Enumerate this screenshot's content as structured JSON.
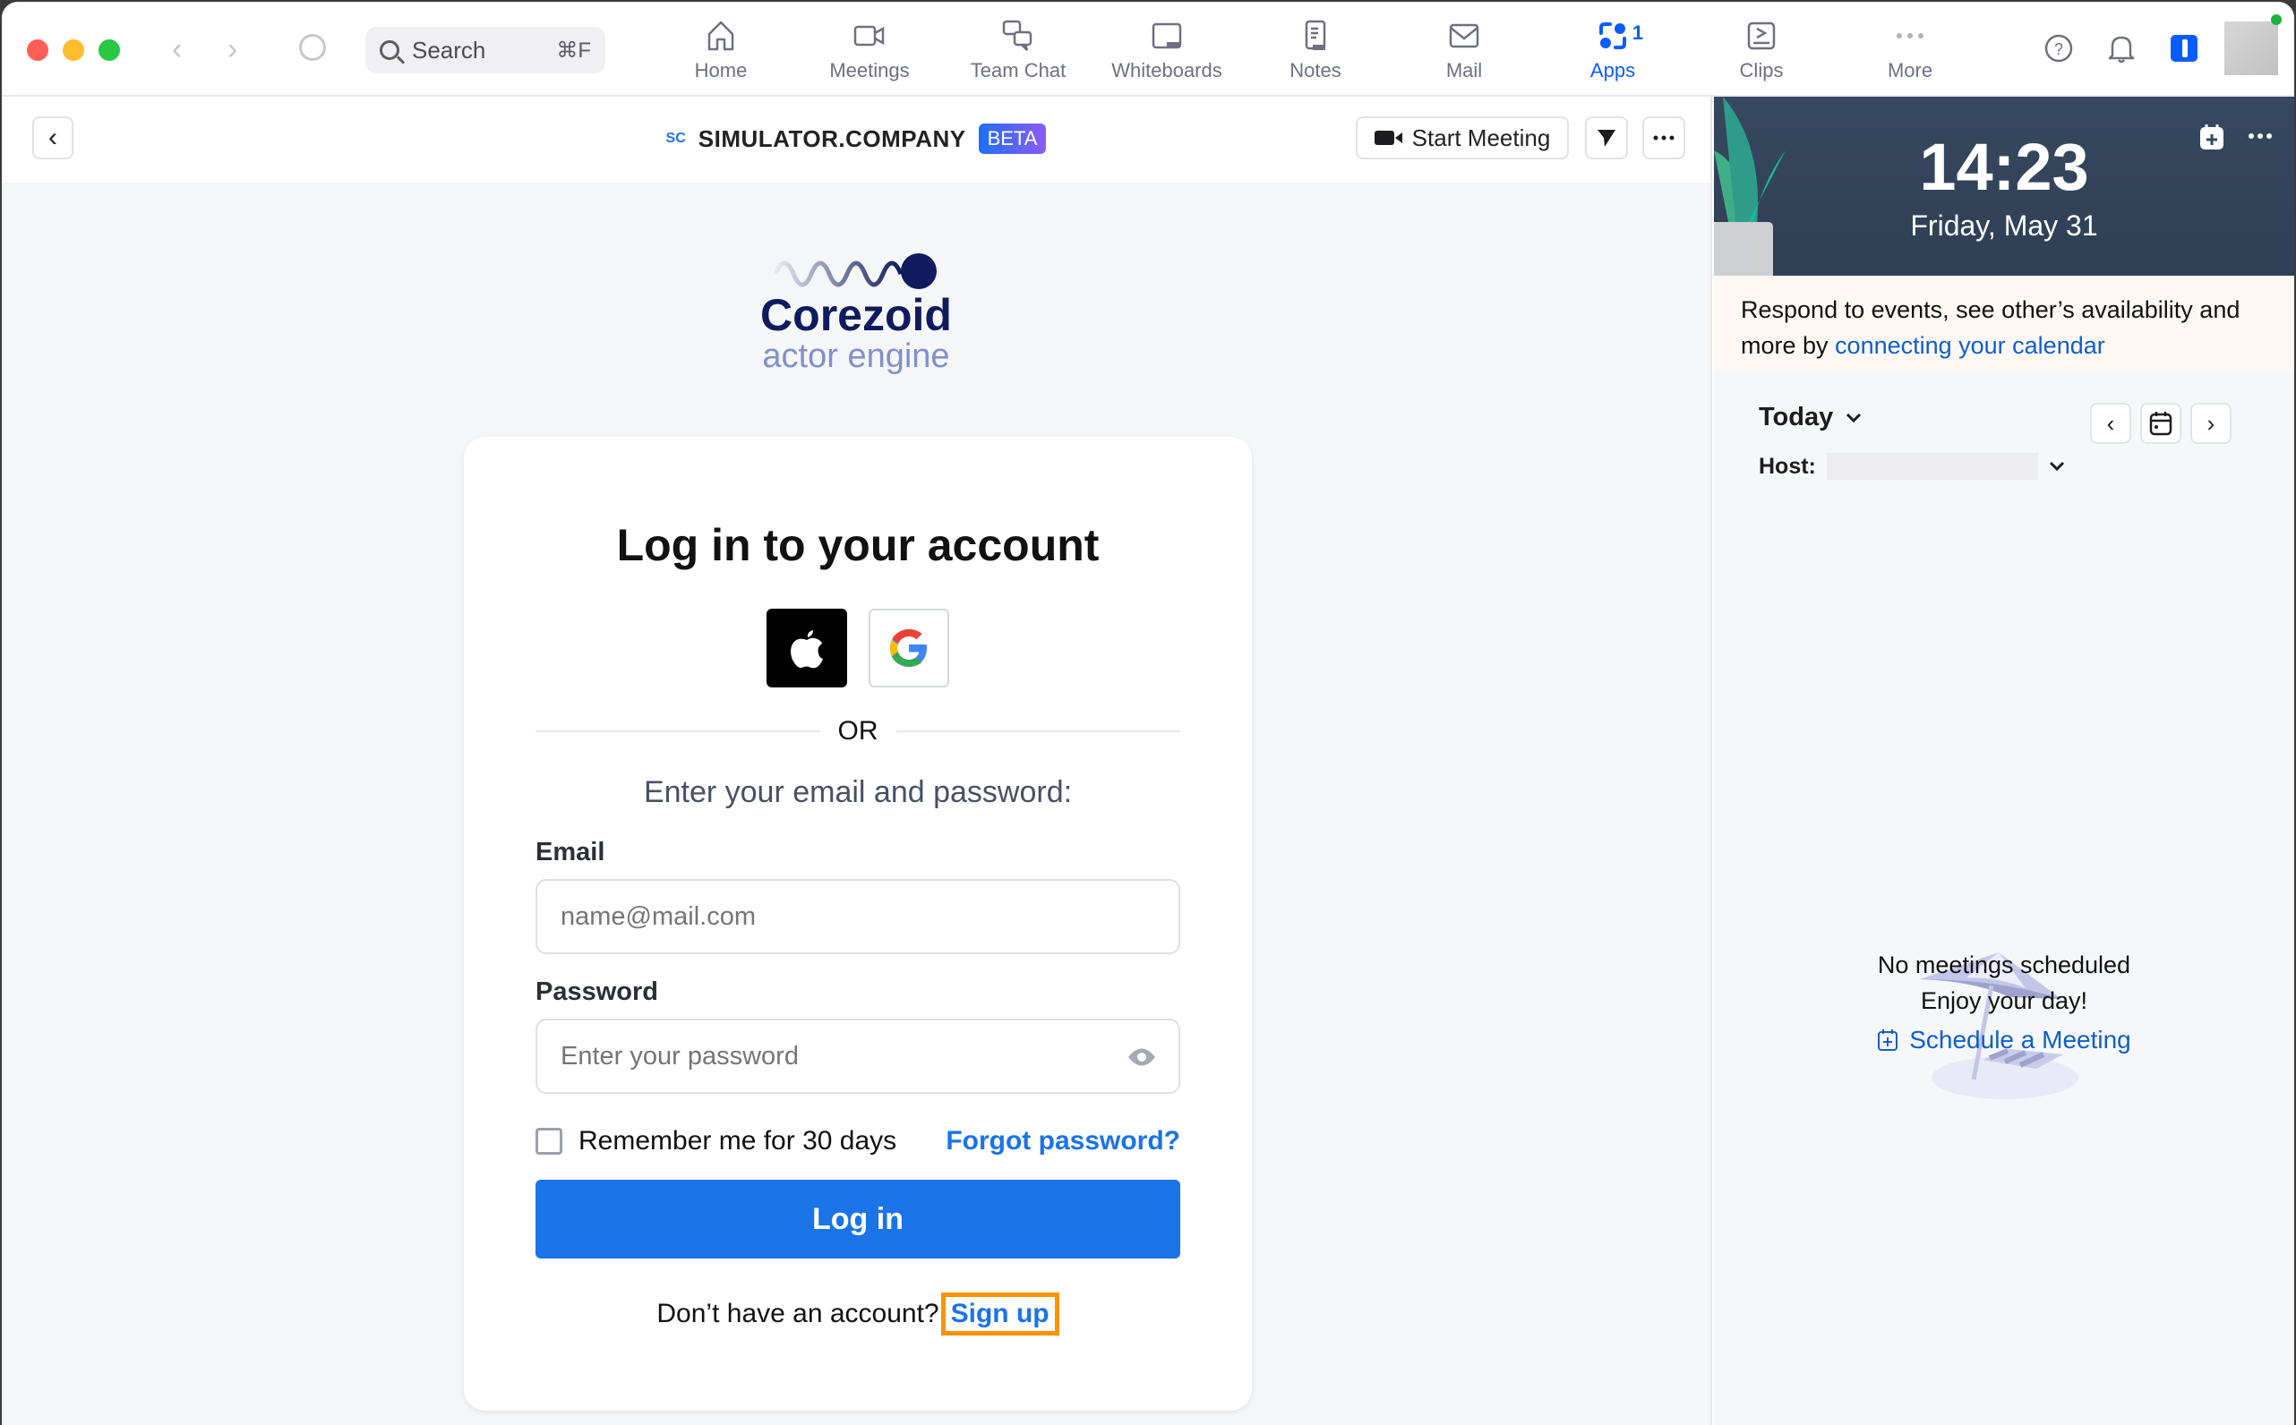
{
  "window": {
    "search": {
      "placeholder": "Search",
      "shortcut": "⌘F"
    },
    "nav": [
      {
        "label": "Home",
        "icon": "home-icon"
      },
      {
        "label": "Meetings",
        "icon": "video-icon"
      },
      {
        "label": "Team Chat",
        "icon": "chat-icon"
      },
      {
        "label": "Whiteboards",
        "icon": "whiteboard-icon"
      },
      {
        "label": "Notes",
        "icon": "notes-icon"
      },
      {
        "label": "Mail",
        "icon": "mail-icon"
      },
      {
        "label": "Apps",
        "icon": "apps-icon",
        "active": true,
        "badge": "1"
      },
      {
        "label": "Clips",
        "icon": "clips-icon"
      },
      {
        "label": "More",
        "icon": "more-dots-icon"
      }
    ],
    "colors": {
      "accent": "#0b5cff",
      "login_button": "#1b73e8",
      "highlight": "#ff9200"
    }
  },
  "app_header": {
    "initials": "SC",
    "company": "SIMULATOR.COMPANY",
    "badge": "BETA",
    "start_meeting": "Start Meeting"
  },
  "logo": {
    "name": "Corezoid",
    "tagline": "actor engine"
  },
  "login": {
    "title": "Log in to your account",
    "or": "OR",
    "subtitle": "Enter your email and password:",
    "email_label": "Email",
    "email_placeholder": "name@mail.com",
    "email_value": "",
    "password_label": "Password",
    "password_placeholder": "Enter your password",
    "password_value": "",
    "remember": "Remember me for 30 days",
    "remember_checked": false,
    "forgot": "Forgot password?",
    "submit": "Log in",
    "no_account": "Don’t have an account?",
    "signup": "Sign up"
  },
  "calendar": {
    "time": "14:23",
    "date": "Friday, May 31",
    "promo_text": "Respond to events, see other’s availability and more by ",
    "promo_link": "connecting your calendar",
    "view": "Today",
    "host_label": "Host:",
    "empty_line1": "No meetings scheduled",
    "empty_line2": "Enjoy your day!",
    "schedule": "Schedule a Meeting"
  }
}
